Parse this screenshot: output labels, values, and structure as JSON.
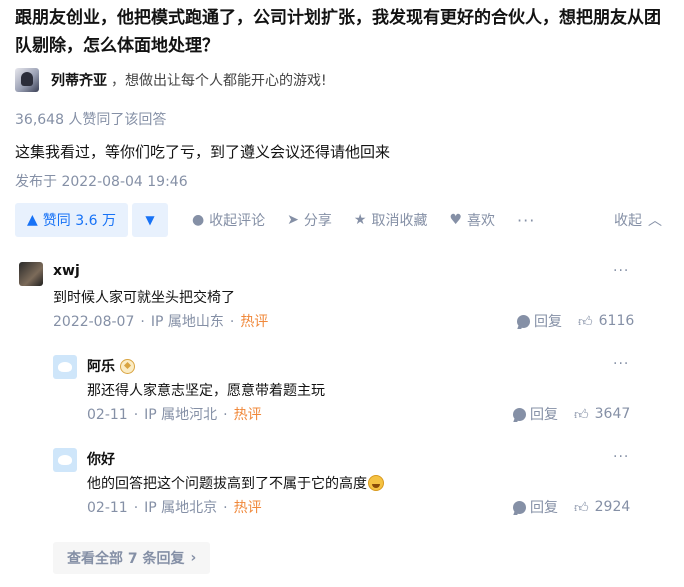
{
  "question": {
    "title": "跟朋友创业，他把模式跑通了，公司计划扩张，我发现有更好的合伙人，想把朋友从团队剔除，怎么体面地处理？"
  },
  "author": {
    "name": "列蒂齐亚",
    "bio": "，想做出让每个人都能开心的游戏!"
  },
  "answer": {
    "vote_count": "36,648 人赞同了该回答",
    "text": "这集我看过，等你们吃了亏，到了遵义会议还得请他回来",
    "publish_time": "发布于 2022-08-04 19:46"
  },
  "actions": {
    "vote_up": "赞同 3.6 万",
    "collapse_comments": "收起评论",
    "share": "分享",
    "uncollect": "取消收藏",
    "like": "喜欢",
    "collapse": "收起"
  },
  "comments": [
    {
      "name": "xwj",
      "text": "到时候人家可就坐头把交椅了",
      "date": "2022-08-07",
      "ip": "IP 属地山东",
      "hot": "热评",
      "reply": "回复",
      "likes": "6116"
    },
    {
      "name": "阿乐",
      "text": "那还得人家意志坚定，愿意带着题主玩",
      "date": "02-11",
      "ip": "IP 属地河北",
      "hot": "热评",
      "reply": "回复",
      "likes": "3647"
    },
    {
      "name": "你好",
      "text": "他的回答把这个问题拔高到了不属于它的高度",
      "date": "02-11",
      "ip": "IP 属地北京",
      "hot": "热评",
      "reply": "回复",
      "likes": "2924"
    }
  ],
  "view_all": "查看全部 7 条回复",
  "colors": {
    "accent": "#1772f6",
    "meta": "#8590a6",
    "hot": "#f0883a"
  }
}
